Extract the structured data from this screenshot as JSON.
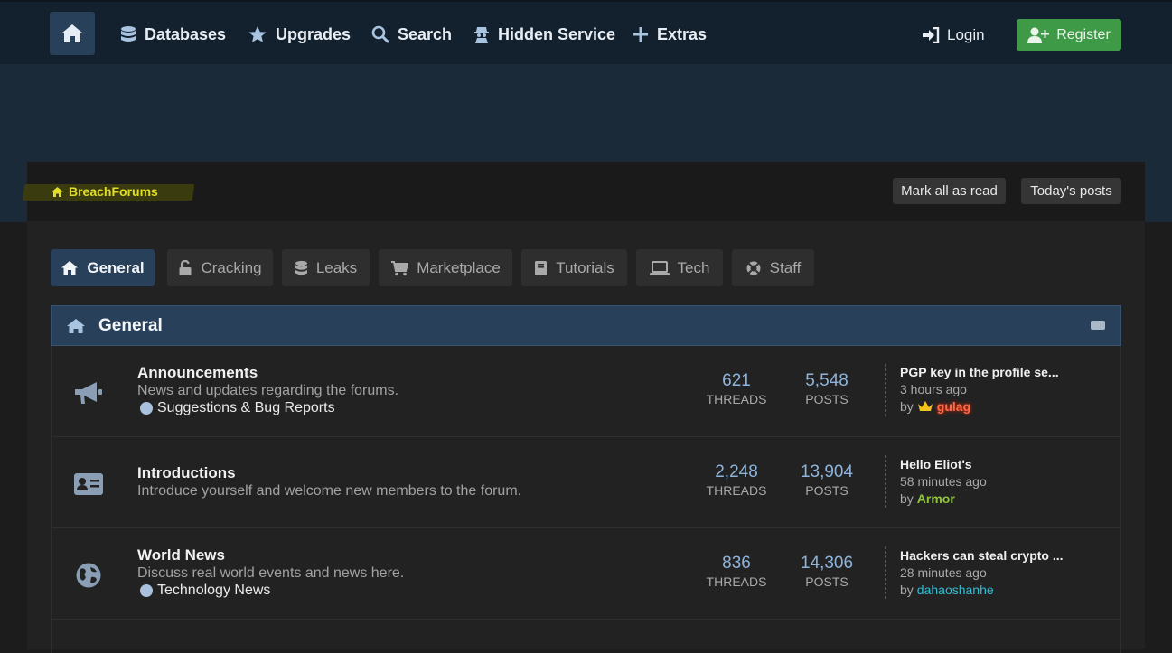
{
  "nav": {
    "items": [
      {
        "label": "Databases",
        "icon": "database-icon"
      },
      {
        "label": "Upgrades",
        "icon": "star-icon"
      },
      {
        "label": "Search",
        "icon": "search-icon"
      },
      {
        "label": "Hidden Service",
        "icon": "user-secret-icon"
      },
      {
        "label": "Extras",
        "icon": "plus-icon"
      }
    ],
    "login": "Login",
    "register": "Register"
  },
  "breadcrumb": {
    "label": "BreachForums",
    "mark_read": "Mark all as read",
    "todays_posts": "Today's posts"
  },
  "tabs": [
    {
      "label": "General",
      "active": true
    },
    {
      "label": "Cracking",
      "active": false
    },
    {
      "label": "Leaks",
      "active": false
    },
    {
      "label": "Marketplace",
      "active": false
    },
    {
      "label": "Tutorials",
      "active": false
    },
    {
      "label": "Tech",
      "active": false
    },
    {
      "label": "Staff",
      "active": false
    }
  ],
  "category": {
    "title": "General"
  },
  "forums": [
    {
      "title": "Announcements",
      "desc": "News and updates regarding the forums.",
      "subforum": "Suggestions & Bug Reports",
      "threads": "621",
      "threads_label": "THREADS",
      "posts": "5,548",
      "posts_label": "POSTS",
      "last_title": "PGP key in the profile se...",
      "last_time": "3 hours ago",
      "by": "by",
      "last_user": "gulag"
    },
    {
      "title": "Introductions",
      "desc": "Introduce yourself and welcome new members to the forum.",
      "threads": "2,248",
      "threads_label": "THREADS",
      "posts": "13,904",
      "posts_label": "POSTS",
      "last_title": "Hello Eliot's",
      "last_time": "58 minutes ago",
      "by": "by",
      "last_user": "Armor"
    },
    {
      "title": "World News",
      "desc": "Discuss real world events and news here.",
      "subforum": "Technology News",
      "threads": "836",
      "threads_label": "THREADS",
      "posts": "14,306",
      "posts_label": "POSTS",
      "last_title": "Hackers can steal crypto ...",
      "last_time": "28 minutes ago",
      "by": "by",
      "last_user": "dahaoshanhe"
    }
  ],
  "colors": {
    "topbar": "#13202d",
    "accent_blue": "#28405a",
    "register_green": "#3f9a48",
    "breadcrumb_yellow": "#e2dd27",
    "stat_blue": "#8eb4db"
  }
}
